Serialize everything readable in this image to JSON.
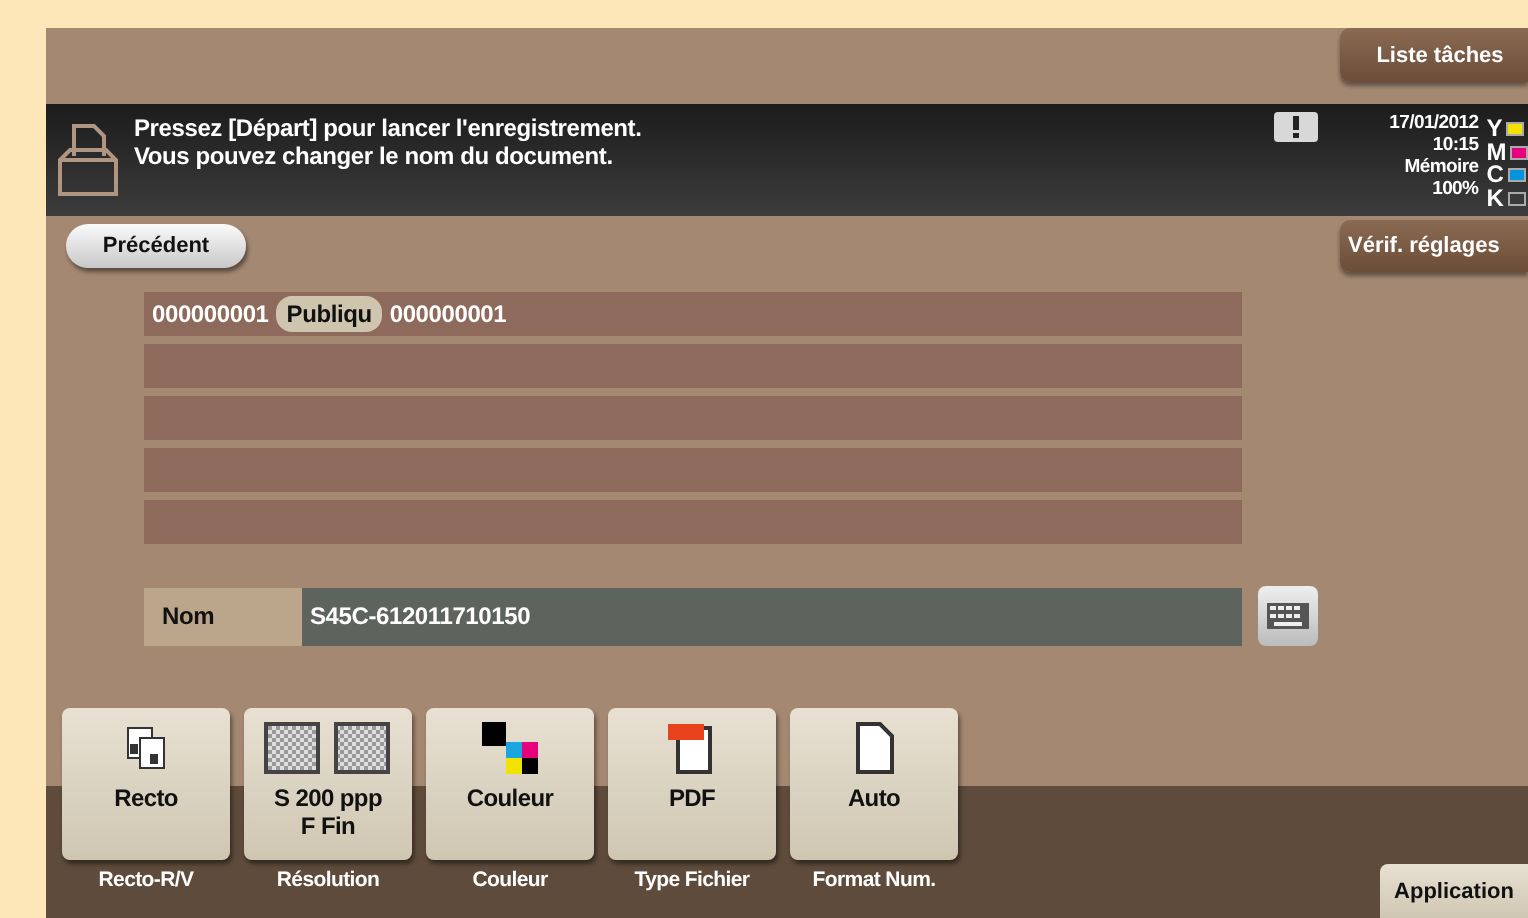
{
  "header_button": "Liste tâches",
  "message": {
    "lines": [
      "Pressez [Départ] pour lancer l'enregistrement.",
      "Vous pouvez changer le nom du document."
    ]
  },
  "status": {
    "date": "17/01/2012",
    "time": "10:15",
    "memory_label": "Mémoire",
    "memory": "100%",
    "toners": [
      {
        "label": "Y",
        "color": "#f2e200"
      },
      {
        "label": "M",
        "color": "#e6007e"
      },
      {
        "label": "C",
        "color": "#0095de"
      },
      {
        "label": "K",
        "color": "#3a3a3a"
      }
    ]
  },
  "back_button": "Précédent",
  "check_button": "Vérif. réglages",
  "documents": [
    {
      "number": "000000001",
      "badge": "Publiqu",
      "name": "000000001"
    }
  ],
  "name_field": {
    "label": "Nom",
    "value": "S45C-612011710150"
  },
  "functions": [
    {
      "kind": "duplex",
      "value": [
        "Recto"
      ],
      "caption": "Recto-R/V"
    },
    {
      "kind": "resolution",
      "value": [
        "S 200 ppp",
        "F Fin"
      ],
      "caption": "Résolution"
    },
    {
      "kind": "color",
      "value": [
        "Couleur"
      ],
      "caption": "Couleur"
    },
    {
      "kind": "pdf",
      "value": [
        "PDF"
      ],
      "caption": "Type Fichier"
    },
    {
      "kind": "page",
      "value": [
        "Auto"
      ],
      "caption": "Format Num."
    }
  ],
  "application_button": "Application"
}
